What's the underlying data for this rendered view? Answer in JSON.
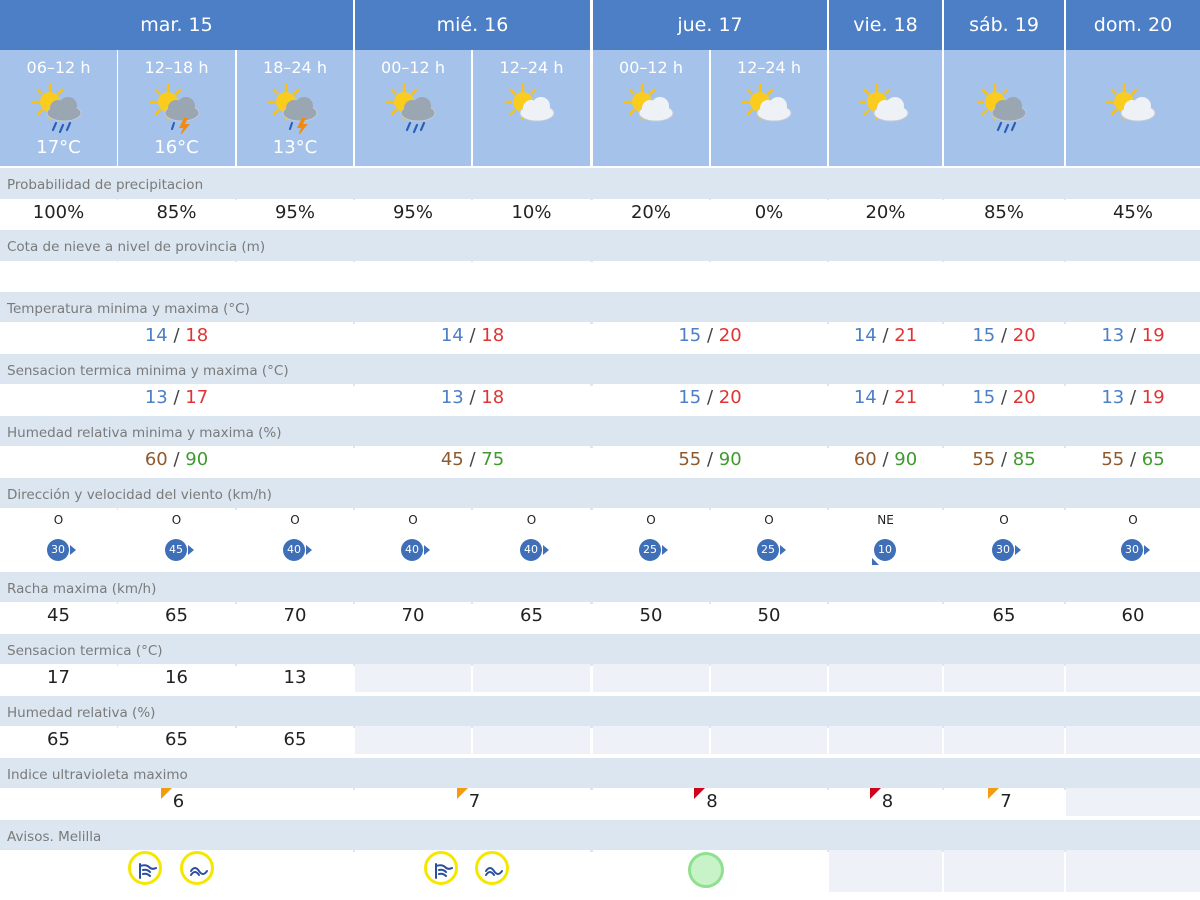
{
  "days": [
    {
      "label": "mar. 15"
    },
    {
      "label": "mié. 16"
    },
    {
      "label": "jue. 17"
    },
    {
      "label": "vie. 18"
    },
    {
      "label": "sáb. 19"
    },
    {
      "label": "dom. 20"
    }
  ],
  "periods": [
    {
      "label": "06–12 h",
      "temp": "17°C",
      "icon": "sun-cloud-rain-icon"
    },
    {
      "label": "12–18 h",
      "temp": "16°C",
      "icon": "sun-cloud-storm-icon"
    },
    {
      "label": "18–24 h",
      "temp": "13°C",
      "icon": "sun-cloud-storm-icon"
    },
    {
      "label": "00–12 h",
      "temp": "",
      "icon": "sun-cloud-rain-icon"
    },
    {
      "label": "12–24 h",
      "temp": "",
      "icon": "sun-cloud-icon"
    },
    {
      "label": "00–12 h",
      "temp": "",
      "icon": "sun-cloud-icon"
    },
    {
      "label": "12–24 h",
      "temp": "",
      "icon": "sun-cloud-icon"
    },
    {
      "label": "",
      "temp": "",
      "icon": "sun-cloud-icon"
    },
    {
      "label": "",
      "temp": "",
      "icon": "sun-cloud-rain-icon"
    },
    {
      "label": "",
      "temp": "",
      "icon": "sun-cloud-icon"
    }
  ],
  "labels": {
    "precip": "Probabilidad de precipitacion",
    "snow": "Cota de nieve a nivel de provincia (m)",
    "temp": "Temperatura minima y maxima (°C)",
    "feels": "Sensacion termica minima y maxima (°C)",
    "humidity": "Humedad relativa minima y maxima (%)",
    "wind": "Dirección y velocidad del viento (km/h)",
    "gust": "Racha maxima (km/h)",
    "feels_now": "Sensacion termica (°C)",
    "hum_now": "Humedad relativa (%)",
    "uv": "Indice ultravioleta maximo",
    "warnings": "Avisos. Melilla"
  },
  "precip": [
    "100%",
    "85%",
    "95%",
    "95%",
    "10%",
    "20%",
    "0%",
    "20%",
    "85%",
    "45%"
  ],
  "snow": [
    "",
    "",
    "",
    "",
    "",
    "",
    "",
    "",
    "",
    ""
  ],
  "temp": [
    {
      "min": "14",
      "max": "18"
    },
    {
      "min": "14",
      "max": "18"
    },
    {
      "min": "15",
      "max": "20"
    },
    {
      "min": "14",
      "max": "21"
    },
    {
      "min": "15",
      "max": "20"
    },
    {
      "min": "13",
      "max": "19"
    }
  ],
  "feels": [
    {
      "min": "13",
      "max": "17"
    },
    {
      "min": "13",
      "max": "18"
    },
    {
      "min": "15",
      "max": "20"
    },
    {
      "min": "14",
      "max": "21"
    },
    {
      "min": "15",
      "max": "20"
    },
    {
      "min": "13",
      "max": "19"
    }
  ],
  "humidity": [
    {
      "min": "60",
      "max": "90"
    },
    {
      "min": "45",
      "max": "75"
    },
    {
      "min": "55",
      "max": "90"
    },
    {
      "min": "60",
      "max": "90"
    },
    {
      "min": "55",
      "max": "85"
    },
    {
      "min": "55",
      "max": "65"
    }
  ],
  "separator": "/",
  "wind": [
    {
      "dir": "O",
      "speed": "30"
    },
    {
      "dir": "O",
      "speed": "45"
    },
    {
      "dir": "O",
      "speed": "40"
    },
    {
      "dir": "O",
      "speed": "40"
    },
    {
      "dir": "O",
      "speed": "40"
    },
    {
      "dir": "O",
      "speed": "25"
    },
    {
      "dir": "O",
      "speed": "25"
    },
    {
      "dir": "NE",
      "speed": "10"
    },
    {
      "dir": "O",
      "speed": "30"
    },
    {
      "dir": "O",
      "speed": "30"
    }
  ],
  "gust": [
    "45",
    "65",
    "70",
    "70",
    "65",
    "50",
    "50",
    "",
    "65",
    "60"
  ],
  "feels_now": [
    "17",
    "16",
    "13"
  ],
  "hum_now": [
    "65",
    "65",
    "65"
  ],
  "uv": [
    "6",
    "7",
    "8",
    "8",
    "7",
    ""
  ],
  "uv_levels": [
    "high",
    "high",
    "very-high",
    "very-high",
    "high",
    ""
  ],
  "colors": {
    "header": "#4d7fc6",
    "subheader": "#a5c2ea",
    "label_bg": "#dbe6f1",
    "min": "#4d7fc6",
    "max": "#e03434",
    "uv_high": "#f39c12",
    "uv_very_high": "#d0021b",
    "warning_yellow": "#f5e700",
    "warning_green": "#8fe08f"
  },
  "warnings": [
    {
      "day": 0,
      "icons": [
        "wind-warning-icon",
        "coastal-warning-icon"
      ]
    },
    {
      "day": 1,
      "icons": [
        "wind-warning-icon",
        "coastal-warning-icon"
      ]
    },
    {
      "day": 2,
      "icons": [
        "no-warning-icon"
      ]
    }
  ]
}
